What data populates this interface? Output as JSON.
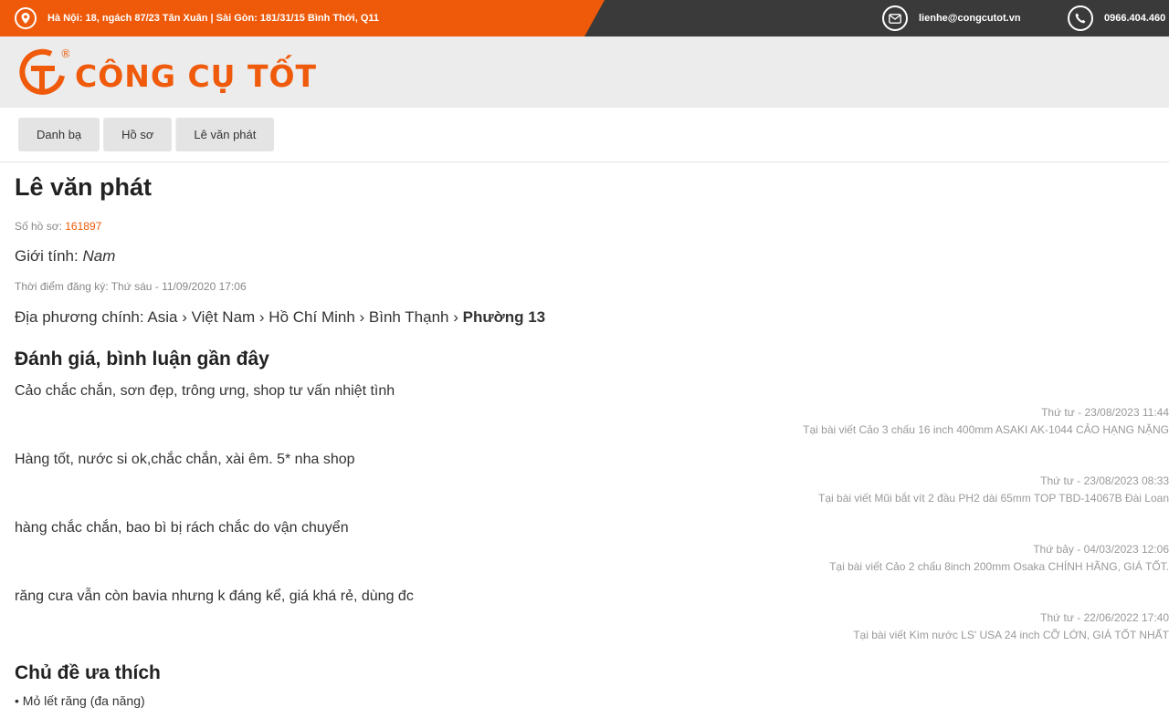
{
  "topbar": {
    "address": "Hà Nội: 18, ngách 87/23 Tân Xuân | Sài Gòn: 181/31/15 Bình Thới, Q11",
    "email": "lienhe@congcutot.vn",
    "phone": "0966.404.460",
    "icons": [
      "location-icon",
      "mail-icon",
      "phone-icon"
    ]
  },
  "logo": {
    "text": "CÔNG CỤ TỐT",
    "mark": "®"
  },
  "breadcrumb": [
    "Danh bạ",
    "Hồ sơ",
    "Lê văn phát"
  ],
  "profile": {
    "name": "Lê văn phát",
    "id_label": "Số hồ sơ:",
    "id_value": "161897",
    "gender_label": "Giới tính:",
    "gender_value": "Nam",
    "registered": "Thời điểm đăng ký: Thứ sáu - 11/09/2020 17:06",
    "location_label": "Địa phương chính:",
    "location_path": "Asia › Việt Nam › Hồ Chí Minh › Bình Thạnh ›",
    "location_last": "Phường 13"
  },
  "reviews": {
    "heading": "Đánh giá, bình luận gần đây",
    "items": [
      {
        "text": "Cảo chắc chắn, sơn đẹp, trông ưng, shop tư vấn nhiệt tình",
        "time": "Thứ tư - 23/08/2023 11:44",
        "post": "Tại bài viết Cảo 3 chấu 16 inch 400mm ASAKI AK-1044 CẢO HẠNG NẶNG"
      },
      {
        "text": "Hàng tốt, nước si ok,chắc chắn, xài êm. 5* nha shop",
        "time": "Thứ tư - 23/08/2023 08:33",
        "post": "Tại bài viết Mũi bắt vít 2 đầu PH2 dài 65mm TOP TBD-14067B Đài Loan"
      },
      {
        "text": "hàng chắc chắn, bao bì bị rách chắc do vận chuyển",
        "time": "Thứ bảy - 04/03/2023 12:06",
        "post": "Tại bài viết Cảo 2 chấu 8inch 200mm Osaka CHÍNH HÃNG, GIÁ TỐT."
      },
      {
        "text": "răng cưa vẫn còn bavia nhưng k đáng kể, giá khá rẻ, dùng đc",
        "time": "Thứ tư - 22/06/2022 17:40",
        "post": "Tại bài viết Kìm nước LS' USA 24 inch CỠ LỚN, GIÁ TỐT NHẤT"
      }
    ]
  },
  "favorites": {
    "heading": "Chủ đề ưa thích",
    "first_item": "Mỏ lết răng (đa năng)"
  },
  "colors": {
    "brand": "#ee5a0a",
    "dark": "#3a3a3a"
  }
}
